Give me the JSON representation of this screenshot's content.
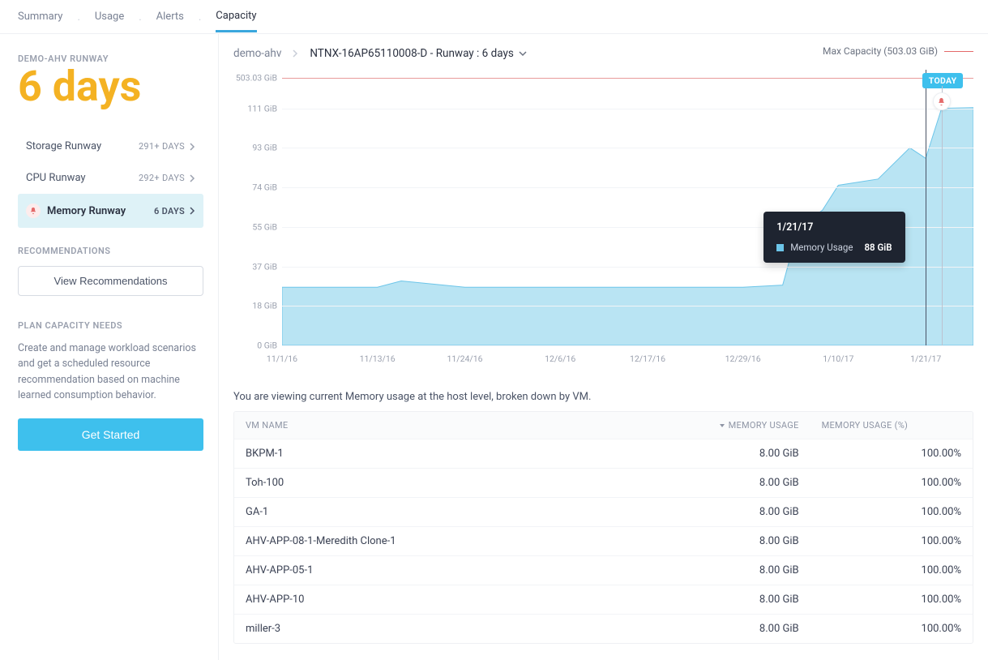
{
  "tabs": [
    "Summary",
    "Usage",
    "Alerts",
    "Capacity"
  ],
  "active_tab": "Capacity",
  "sidebar": {
    "cluster_label": "DEMO-AHV RUNWAY",
    "runway_big": "6 days",
    "rows": [
      {
        "label": "Storage Runway",
        "value": "291+ DAYS",
        "alert": false,
        "active": false
      },
      {
        "label": "CPU Runway",
        "value": "292+ DAYS",
        "alert": false,
        "active": false
      },
      {
        "label": "Memory Runway",
        "value": "6 DAYS",
        "alert": true,
        "active": true
      }
    ],
    "recommendations_h": "RECOMMENDATIONS",
    "view_rec_btn": "View Recommendations",
    "plan_h": "PLAN CAPACITY NEEDS",
    "plan_text": "Create and manage workload scenarios and get a scheduled resource recommendation based on machine learned consumption behavior.",
    "get_started_btn": "Get Started"
  },
  "breadcrumb": {
    "cluster": "demo-ahv",
    "node": "NTNX-16AP65110008-D - Runway : 6 days"
  },
  "max_capacity_label": "Max Capacity (503.03 GiB)",
  "today_label": "TODAY",
  "tooltip": {
    "date": "1/21/17",
    "series_label": "Memory Usage",
    "value": "88 GiB"
  },
  "subtext": "You are viewing current Memory usage at the host level, broken down by VM.",
  "table": {
    "headers": [
      "VM NAME",
      "MEMORY USAGE",
      "MEMORY USAGE (%)"
    ],
    "rows": [
      {
        "name": "BKPM-1",
        "usage": "8.00 GiB",
        "pct": "100.00%"
      },
      {
        "name": "Toh-100",
        "usage": "8.00 GiB",
        "pct": "100.00%"
      },
      {
        "name": "GA-1",
        "usage": "8.00 GiB",
        "pct": "100.00%"
      },
      {
        "name": "AHV-APP-08-1-Meredith Clone-1",
        "usage": "8.00 GiB",
        "pct": "100.00%"
      },
      {
        "name": "AHV-APP-05-1",
        "usage": "8.00 GiB",
        "pct": "100.00%"
      },
      {
        "name": "AHV-APP-10",
        "usage": "8.00 GiB",
        "pct": "100.00%"
      },
      {
        "name": "miller-3",
        "usage": "8.00 GiB",
        "pct": "100.00%"
      }
    ]
  },
  "chart_data": {
    "type": "area",
    "title": "Memory Usage",
    "ylabel": "GiB",
    "y_ticks": [
      {
        "label": "503.03 GiB",
        "value": 503.03
      },
      {
        "label": "111 GiB",
        "value": 111
      },
      {
        "label": "93 GiB",
        "value": 93
      },
      {
        "label": "74 GiB",
        "value": 74
      },
      {
        "label": "55 GiB",
        "value": 55
      },
      {
        "label": "37 GiB",
        "value": 37
      },
      {
        "label": "18 GiB",
        "value": 18
      },
      {
        "label": "0 GiB",
        "value": 0
      }
    ],
    "x_ticks": [
      "11/1/16",
      "11/13/16",
      "11/24/16",
      "12/6/16",
      "12/17/16",
      "12/29/16",
      "1/10/17",
      "1/21/17"
    ],
    "series": [
      {
        "name": "Memory Usage",
        "color": "#a9def0",
        "points": [
          {
            "x": "11/1/16",
            "y": 27
          },
          {
            "x": "11/13/16",
            "y": 27
          },
          {
            "x": "11/16/16",
            "y": 30
          },
          {
            "x": "11/24/16",
            "y": 27
          },
          {
            "x": "12/6/16",
            "y": 27
          },
          {
            "x": "12/17/16",
            "y": 27
          },
          {
            "x": "12/29/16",
            "y": 27
          },
          {
            "x": "1/3/17",
            "y": 28
          },
          {
            "x": "1/5/17",
            "y": 55
          },
          {
            "x": "1/8/17",
            "y": 63
          },
          {
            "x": "1/10/17",
            "y": 75
          },
          {
            "x": "1/15/17",
            "y": 78
          },
          {
            "x": "1/19/17",
            "y": 93
          },
          {
            "x": "1/21/17",
            "y": 88
          },
          {
            "x": "1/23/17",
            "y": 111
          },
          {
            "x": "1/27/17",
            "y": 120
          }
        ]
      }
    ],
    "max_capacity": 503.03,
    "today_x": "1/23/17",
    "hover_x": "1/21/17"
  }
}
